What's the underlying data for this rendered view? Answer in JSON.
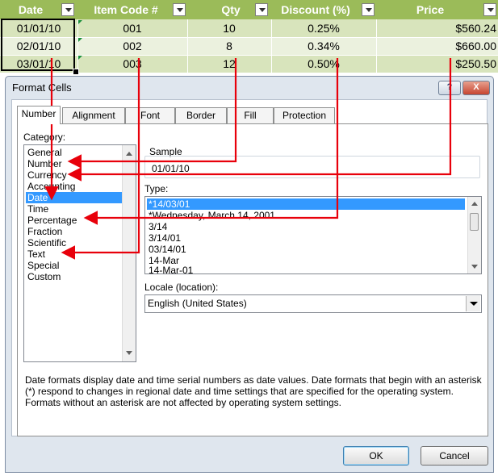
{
  "spreadsheet": {
    "headers": [
      "Date",
      "Item Code #",
      "Qty",
      "Discount (%)",
      "Price"
    ],
    "rows": [
      [
        "01/01/10",
        "001",
        "10",
        "0.25%",
        "$560.24"
      ],
      [
        "02/01/10",
        "002",
        "8",
        "0.34%",
        "$660.00"
      ],
      [
        "03/01/10",
        "003",
        "12",
        "0.50%",
        "$250.50"
      ]
    ]
  },
  "dialog": {
    "title": "Format Cells",
    "help_label": "?",
    "close_label": "X",
    "tabs": [
      "Number",
      "Alignment",
      "Font",
      "Border",
      "Fill",
      "Protection"
    ],
    "active_tab": "Number",
    "category_label": "Category:",
    "categories": [
      "General",
      "Number",
      "Currency",
      "Accounting",
      "Date",
      "Time",
      "Percentage",
      "Fraction",
      "Scientific",
      "Text",
      "Special",
      "Custom"
    ],
    "selected_category": "Date",
    "sample_label": "Sample",
    "sample_value": "01/01/10",
    "type_label": "Type:",
    "types": [
      "*14/03/01",
      "*Wednesday, March 14, 2001",
      "3/14",
      "3/14/01",
      "03/14/01",
      "14-Mar",
      "14-Mar-01"
    ],
    "selected_type": "*14/03/01",
    "locale_label": "Locale (location):",
    "locale_value": "English (United States)",
    "description": "Date formats display date and time serial numbers as date values.  Date formats that begin with an asterisk (*) respond to changes in regional date and time settings that are specified for the operating system. Formats without an asterisk are not affected by operating system settings.",
    "ok_label": "OK",
    "cancel_label": "Cancel"
  },
  "colors": {
    "header_bg": "#9bbb59",
    "row_odd": "#d8e4bc",
    "row_even": "#ebf1de",
    "selection": "#3399ff",
    "arrow": "#e8000b"
  }
}
